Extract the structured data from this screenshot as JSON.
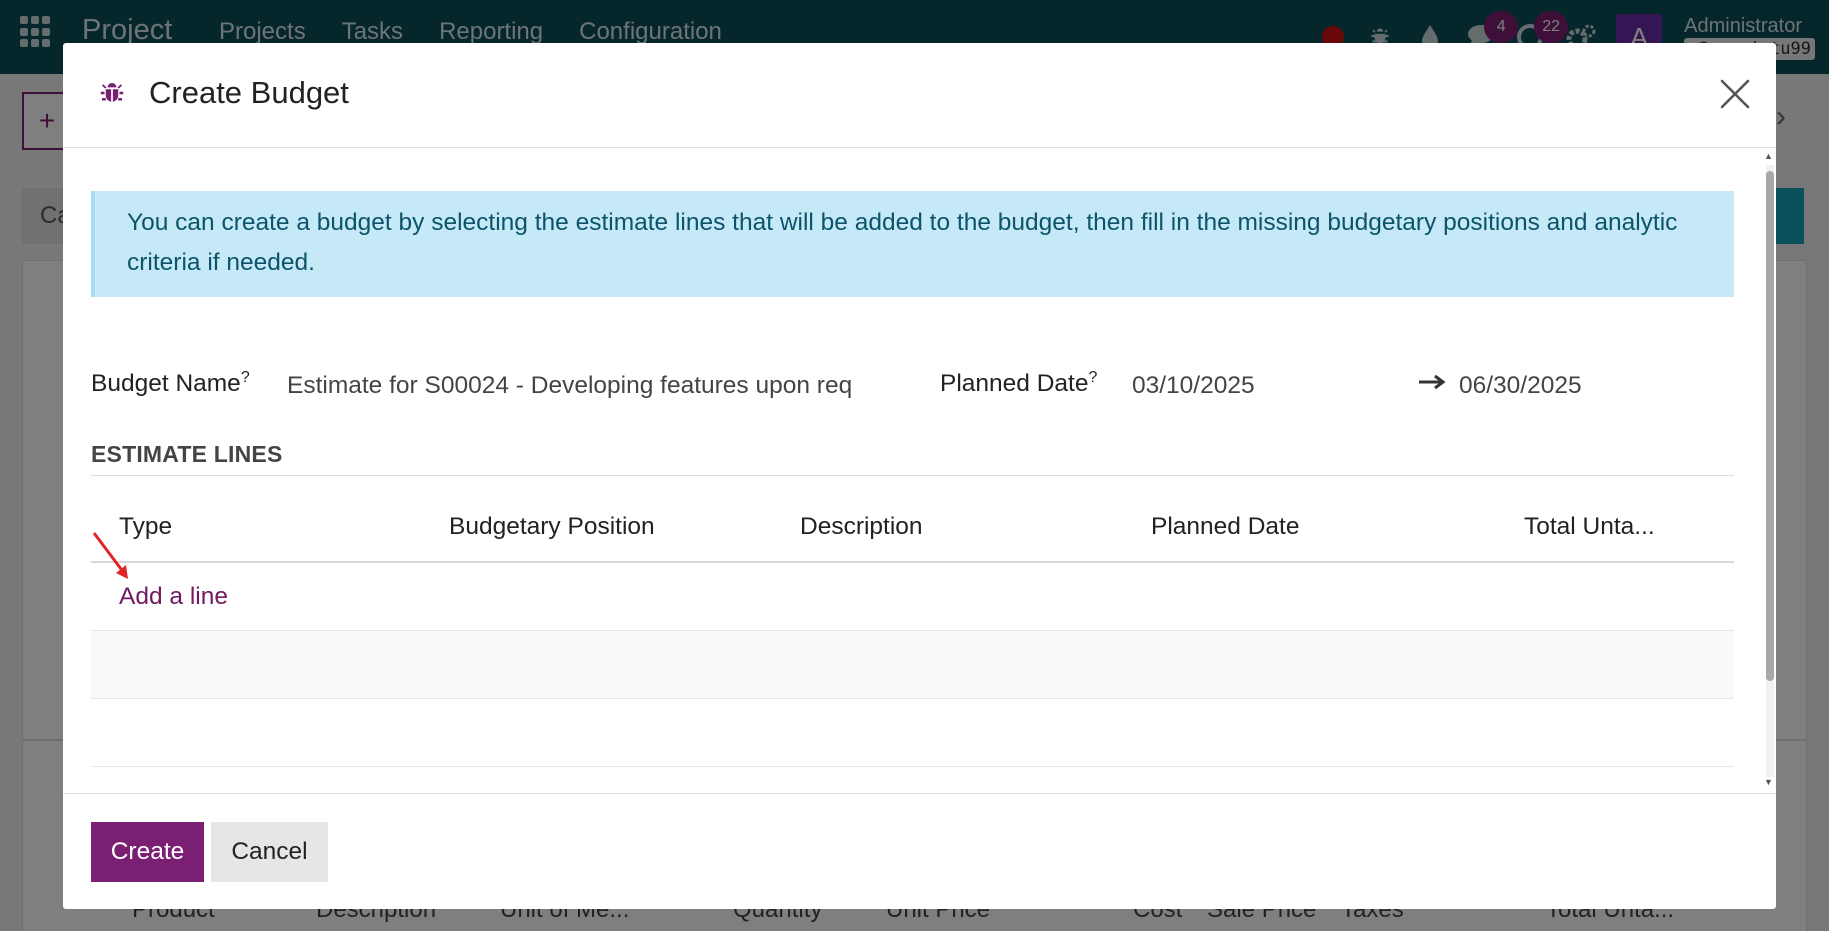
{
  "navbar": {
    "brand": "Project",
    "menu": [
      "Projects",
      "Tasks",
      "Reporting",
      "Configuration"
    ],
    "chat_badge": "4",
    "activity_badge": "22",
    "avatar_letter": "A",
    "user_name": "Administrator",
    "database": "m8cacnistu99"
  },
  "background": {
    "tab_label": "Ca",
    "columns": [
      "Product",
      "Description",
      "Unit of Me...",
      "Quantity",
      "Unit Price",
      "Cost",
      "Sale Price",
      "Taxes",
      "Total Unta..."
    ]
  },
  "modal": {
    "title": "Create Budget",
    "alert": "You can create a budget by selecting the estimate lines that will be added to the budget, then fill in the missing budgetary positions and analytic criteria if needed.",
    "budget_name_label": "Budget Name",
    "budget_name_value": "Estimate for S00024 - Developing features upon req",
    "planned_date_label": "Planned Date",
    "help_mark": "?",
    "date_start": "03/10/2025",
    "date_end": "06/30/2025",
    "section_title": "ESTIMATE LINES",
    "columns": [
      "Type",
      "Budgetary Position",
      "Description",
      "Planned Date",
      "Total Unta..."
    ],
    "add_line": "Add a line",
    "create_label": "Create",
    "cancel_label": "Cancel"
  },
  "colors": {
    "primary": "#7b1f73",
    "navbar": "#0a4f58",
    "alert_bg": "#c6e9f8",
    "alert_text": "#0c5469"
  }
}
